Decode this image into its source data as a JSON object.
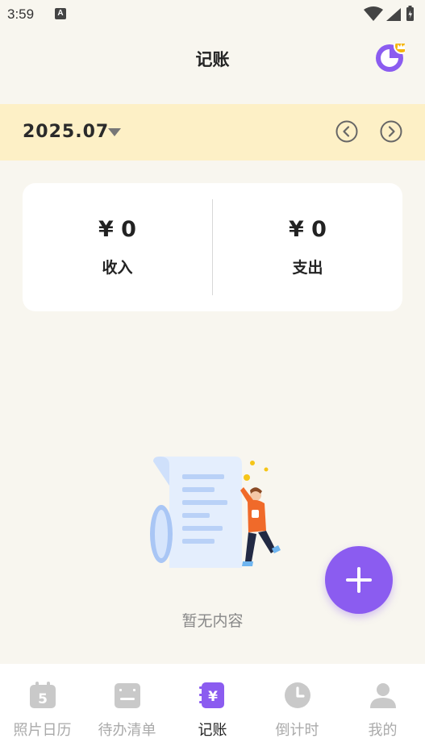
{
  "status_bar": {
    "time": "3:59",
    "notification_letter": "A"
  },
  "header": {
    "title": "记账"
  },
  "date_bar": {
    "month": "2025.07"
  },
  "summary": {
    "income_amount": "¥ 0",
    "income_label": "收入",
    "expense_amount": "¥ 0",
    "expense_label": "支出"
  },
  "empty_state": {
    "text": "暂无内容"
  },
  "tabs": [
    {
      "label": "照片日历",
      "icon": "calendar-icon",
      "badge": "5"
    },
    {
      "label": "待办清单",
      "icon": "todo-list-icon"
    },
    {
      "label": "记账",
      "icon": "yuan-icon",
      "badge": "¥"
    },
    {
      "label": "倒计时",
      "icon": "clock-icon"
    },
    {
      "label": "我的",
      "icon": "person-icon"
    }
  ],
  "colors": {
    "accent": "#8b5cf0",
    "date_bar_bg": "#fdf0c6",
    "background": "#f8f6ef",
    "crown": "#f5b50a"
  }
}
